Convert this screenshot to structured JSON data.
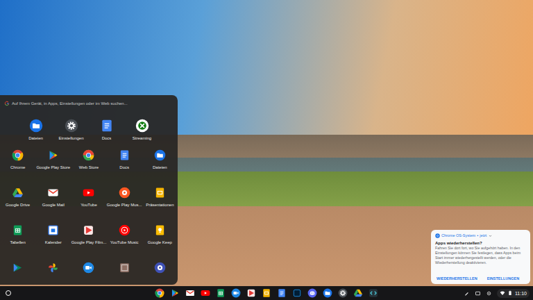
{
  "launcher": {
    "search": {
      "placeholder": "Auf Ihrem Gerät, in Apps, Einstellungen oder im Web suchen..."
    },
    "suggestions": [
      {
        "label": "Dateien"
      },
      {
        "label": "Einstellungen"
      },
      {
        "label": "Docs"
      },
      {
        "label": "Streaming"
      }
    ],
    "apps": [
      {
        "label": "Chrome"
      },
      {
        "label": "Google Play Store"
      },
      {
        "label": "Web Store"
      },
      {
        "label": "Docs"
      },
      {
        "label": "Dateien"
      },
      {
        "label": "Google Drive"
      },
      {
        "label": "Google Mail"
      },
      {
        "label": "YouTube"
      },
      {
        "label": "Google Play Mus..."
      },
      {
        "label": "Präsentationen"
      },
      {
        "label": "Tabellen"
      },
      {
        "label": "Kalender"
      },
      {
        "label": "Google Play Film..."
      },
      {
        "label": "YouTube Music"
      },
      {
        "label": "Google Keep"
      },
      {
        "label": ""
      },
      {
        "label": ""
      },
      {
        "label": ""
      },
      {
        "label": ""
      },
      {
        "label": ""
      }
    ]
  },
  "notification": {
    "source": "Chrome OS-System",
    "separator": "•",
    "time": "jetzt",
    "title": "Apps wiederherstellen?",
    "body": "Fahren Sie dort fort, wo Sie aufgehört haben. In den Einstellungen können Sie festlegen, dass Apps beim Start immer wiederhergestellt werden, oder die Wiederherstellung deaktivieren.",
    "buttons": [
      "WIEDERHERSTELLEN",
      "EINSTELLUNGEN"
    ]
  },
  "shelf": {
    "time": "11:10"
  }
}
